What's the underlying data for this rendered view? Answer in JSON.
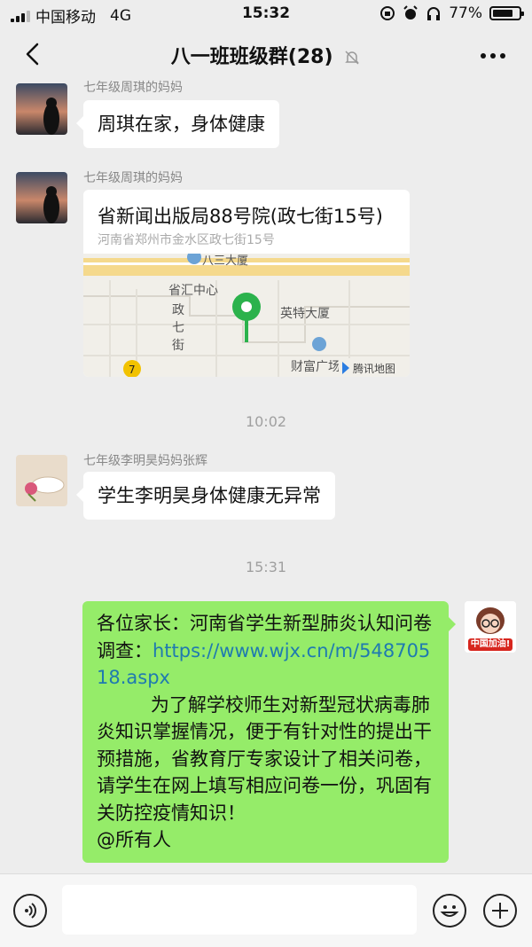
{
  "status_bar": {
    "carrier": "中国移动",
    "network": "4G",
    "time": "15:32",
    "battery": "77%",
    "battery_level": 0.77
  },
  "header": {
    "title": "八一班班级群(28)"
  },
  "messages": [
    {
      "sender": "七年级周琪的妈妈",
      "text": "周琪在家，身体健康"
    },
    {
      "sender": "七年级周琪的妈妈",
      "location": {
        "title": "省新闻出版局88号院(政七街15号)",
        "address": "河南省郑州市金水区政七街15号",
        "map_labels": {
          "top_label": "八三大厦",
          "center_label": "省汇中心",
          "street_1": "政",
          "street_2": "七",
          "street_3": "街",
          "building_1": "英特大厦",
          "building_2": "财富广场",
          "road_badge": "7",
          "provider": "腾讯地图"
        }
      }
    },
    {
      "time_divider": "10:02"
    },
    {
      "sender": "七年级李明昊妈妈张辉",
      "text": "学生李明昊身体健康无异常"
    },
    {
      "time_divider": "15:31"
    },
    {
      "mine": true,
      "avatar_badge": "中国加油!",
      "text_intro": "各位家长：河南省学生新型肺炎认知问卷调查：",
      "link": "https://www.wjx.cn/m/54870518.aspx",
      "text_body": "为了解学校师生对新型冠状病毒肺炎知识掌握情况，便于有针对性的提出干预措施，省教育厅专家设计了相关问卷，请学生在网上填写相应问卷一份，巩固有关防控疫情知识！",
      "mention": "@所有人"
    }
  ],
  "colors": {
    "chat_background": "#ededed",
    "my_bubble": "#95ec69",
    "link": "#1f7ab0",
    "pin": "#2bb24c"
  }
}
